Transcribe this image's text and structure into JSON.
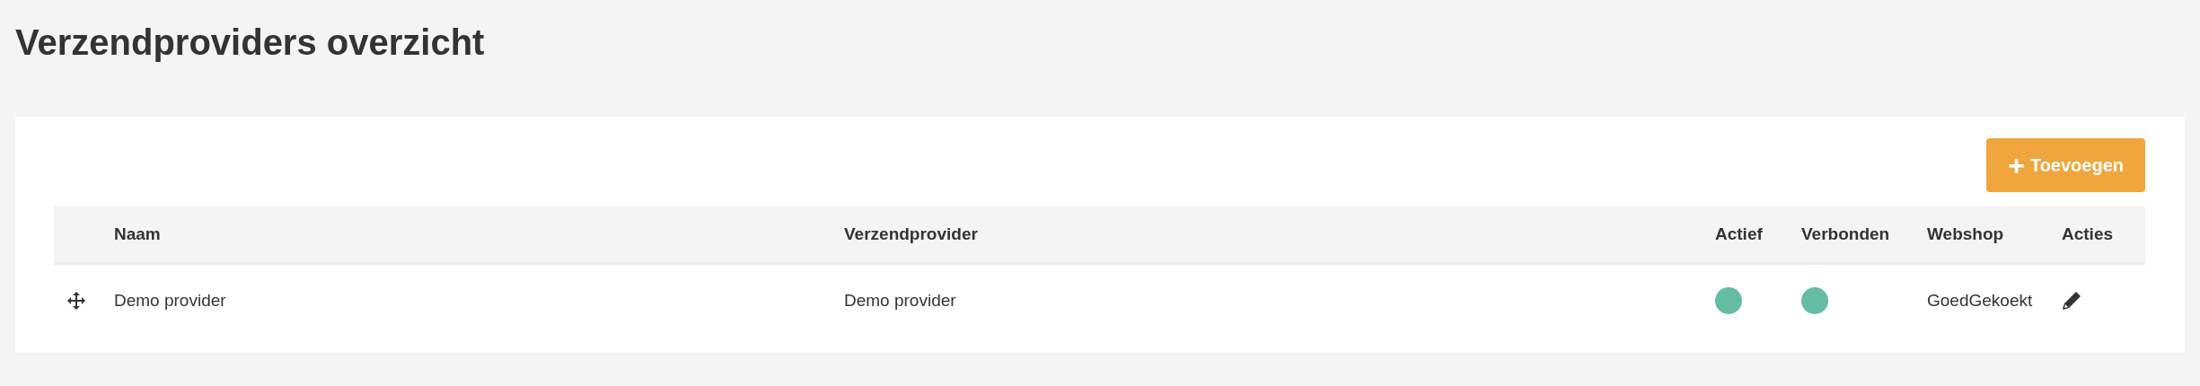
{
  "page_title": "Verzendproviders overzicht",
  "add_button": {
    "icon": "+",
    "label": "Toevoegen"
  },
  "table": {
    "columns": [
      "Naam",
      "Verzendprovider",
      "Actief",
      "Verbonden",
      "Webshop",
      "Acties"
    ],
    "rows": [
      {
        "naam": "Demo provider",
        "verzendprovider": "Demo provider",
        "actief": true,
        "verbonden": true,
        "webshop": "GoedGekoekt"
      }
    ]
  }
}
